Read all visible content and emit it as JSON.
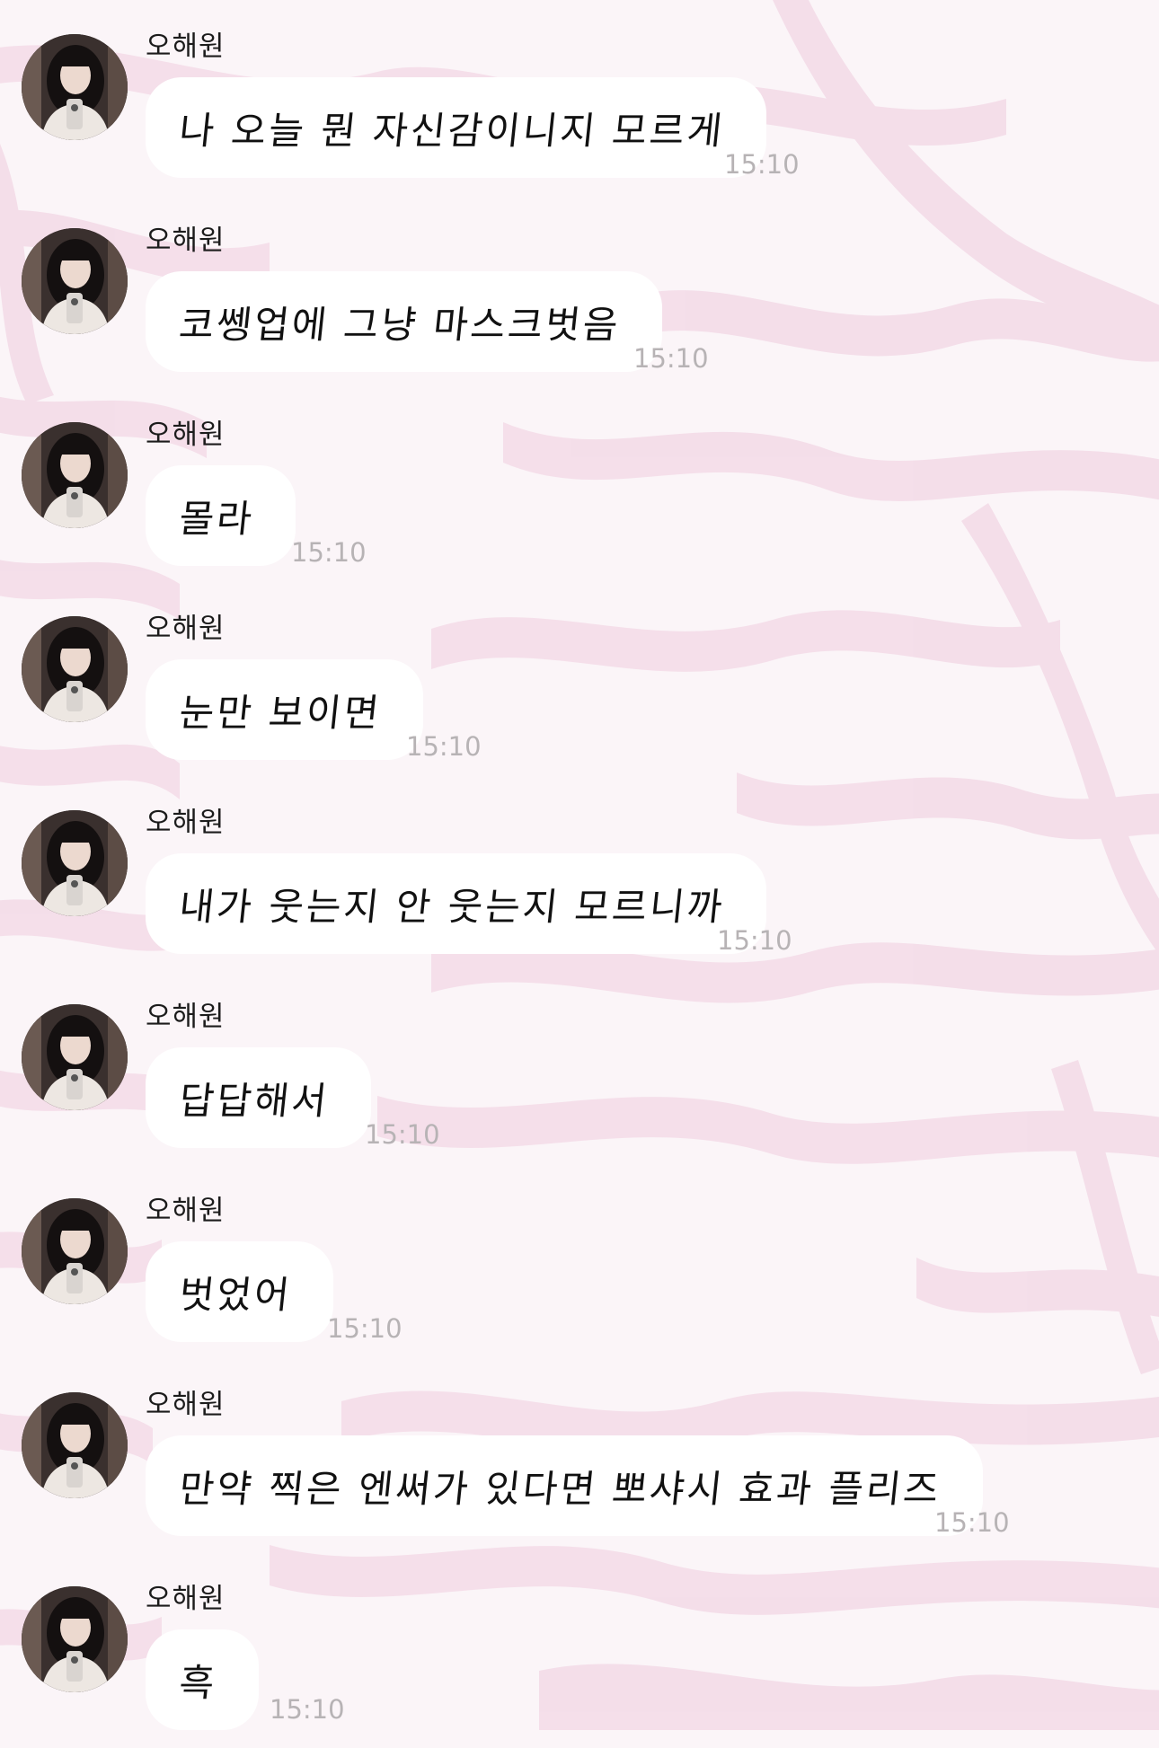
{
  "background": {
    "accent": "#f5dcea",
    "base": "#fbf5f8"
  },
  "chat": {
    "messages": [
      {
        "sender": "오해원",
        "text": "나 오늘 뭔 자신감이니지 모르게",
        "time": "15:10"
      },
      {
        "sender": "오해원",
        "text": "코쎙업에 그냥 마스크벗음",
        "time": "15:10"
      },
      {
        "sender": "오해원",
        "text": "몰라",
        "time": "15:10"
      },
      {
        "sender": "오해원",
        "text": "눈만 보이면",
        "time": "15:10"
      },
      {
        "sender": "오해원",
        "text": "내가 웃는지 안 웃는지 모르니까",
        "time": "15:10"
      },
      {
        "sender": "오해원",
        "text": "답답해서",
        "time": "15:10"
      },
      {
        "sender": "오해원",
        "text": "벗었어",
        "time": "15:10"
      },
      {
        "sender": "오해원",
        "text": "만약 찍은 엔써가 있다면 뽀샤시 효과 플리즈",
        "time": "15:10"
      },
      {
        "sender": "오해원",
        "text": "흑",
        "time": "15:10"
      }
    ]
  }
}
